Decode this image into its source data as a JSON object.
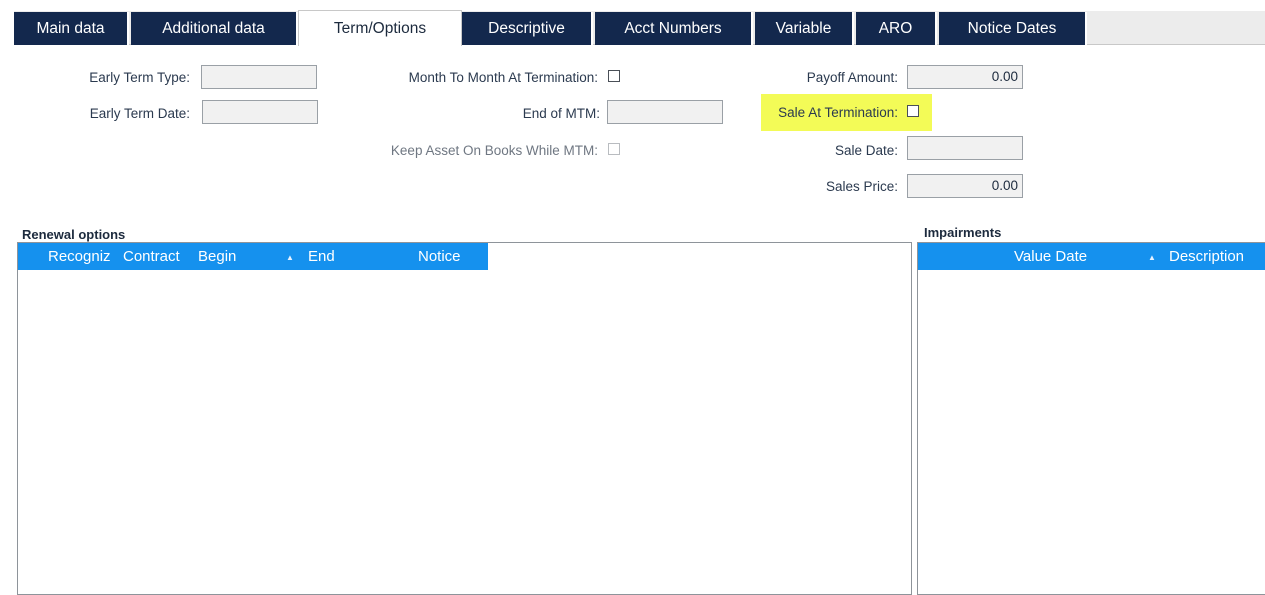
{
  "tabs": [
    {
      "label": "Main data"
    },
    {
      "label": "Additional data"
    },
    {
      "label": "Term/Options"
    },
    {
      "label": "Descriptive"
    },
    {
      "label": "Acct Numbers"
    },
    {
      "label": "Variable"
    },
    {
      "label": "ARO"
    },
    {
      "label": "Notice Dates"
    }
  ],
  "form": {
    "early_term_type_label": "Early Term Type:",
    "early_term_type_value": "",
    "early_term_date_label": "Early Term Date:",
    "early_term_date_value": "",
    "mtm_at_termination_label": "Month To Month At Termination:",
    "end_of_mtm_label": "End of MTM:",
    "end_of_mtm_value": "",
    "keep_asset_label": "Keep Asset On Books While MTM:",
    "payoff_amount_label": "Payoff Amount:",
    "payoff_amount_value": "0.00",
    "sale_at_termination_label": "Sale At Termination:",
    "sale_date_label": "Sale Date:",
    "sale_date_value": "",
    "sales_price_label": "Sales Price:",
    "sales_price_value": "0.00",
    "highlight_color": "#f3fb57"
  },
  "renewal_options": {
    "title": "Renewal options",
    "columns": [
      "Recogniz",
      "Contract",
      "Begin",
      "End",
      "Notice"
    ],
    "sort_indicator": "▲",
    "rows": []
  },
  "impairments": {
    "title": "Impairments",
    "columns": [
      "Value Date",
      "Description"
    ],
    "sort_indicator": "▲",
    "rows": []
  },
  "colors": {
    "tab_bg": "#13284d",
    "grid_header": "#1591ee"
  }
}
